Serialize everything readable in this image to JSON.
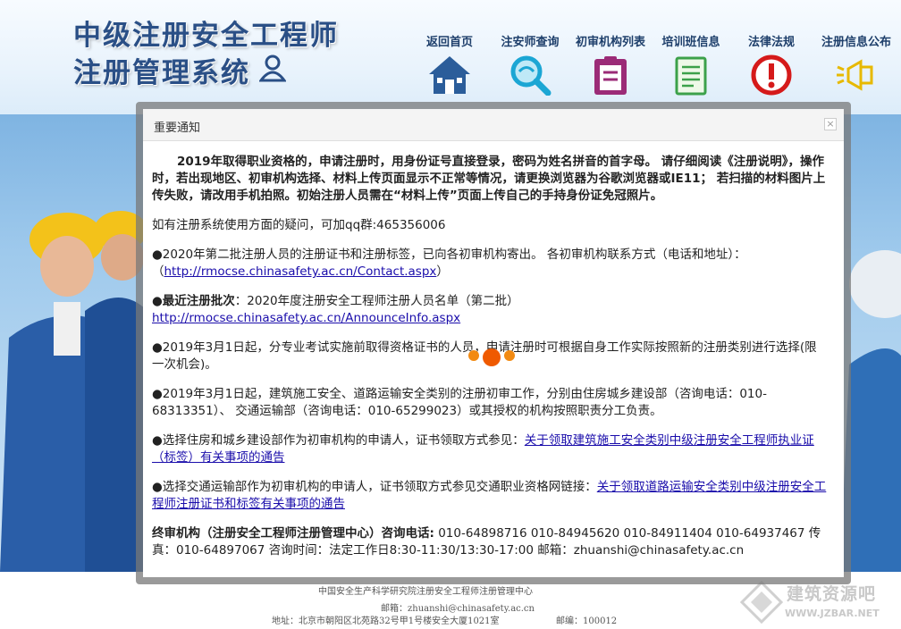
{
  "header": {
    "title_line1": "中级注册安全工程师",
    "title_line2": "注册管理系统",
    "nav": [
      {
        "label": "返回首页",
        "icon": "house-icon"
      },
      {
        "label": "注安师查询",
        "icon": "magnifier-icon"
      },
      {
        "label": "初审机构列表",
        "icon": "clipboard-icon"
      },
      {
        "label": "培训班信息",
        "icon": "document-icon"
      },
      {
        "label": "法律法规",
        "icon": "alert-icon"
      },
      {
        "label": "注册信息公布",
        "icon": "megaphone-icon"
      }
    ]
  },
  "modal": {
    "title": "重要通知",
    "close": "×",
    "intro": "2019年取得职业资格的，申请注册时，用身份证号直接登录，密码为姓名拼音的首字母。 请仔细阅读《注册说明》，操作时，若出现地区、初审机构选择、材料上传页面显示不正常等情况，请更换浏览器为谷歌浏览器或IE11； 若扫描的材料图片上传失败，请改用手机拍照。初始注册人员需在“材料上传”页面上传自己的手持身份证免冠照片。",
    "qq": "如有注册系统使用方面的疑问，可加qq群:465356006",
    "p1_text": "●2020年第二批注册人员的注册证书和注册标签，已向各初审机构寄出。 各初审机构联系方式（电话和地址）：（",
    "p1_link": "http://rmocse.chinasafety.ac.cn/Contact.aspx",
    "p1_end": "）",
    "p2_bold": "●最近注册批次",
    "p2_text": "：2020年度注册安全工程师注册人员名单（第二批）",
    "p2_link": "http://rmocse.chinasafety.ac.cn/AnnounceInfo.aspx",
    "p3": "●2019年3月1日起，分专业考试实施前取得资格证书的人员，申请注册时可根据自身工作实际按照新的注册类别进行选择(限一次机会)。",
    "p4": "●2019年3月1日起，建筑施工安全、道路运输安全类别的注册初审工作，分别由住房城乡建设部（咨询电话：010-68313351）、 交通运输部（咨询电话：010-65299023）或其授权的机构按照职责分工负责。",
    "p5_text": "●选择住房和城乡建设部作为初审机构的申请人，证书领取方式参见：",
    "p5_link": "关于领取建筑施工安全类别中级注册安全工程师执业证（标签）有关事项的通告",
    "p6_text": "●选择交通运输部作为初审机构的申请人，证书领取方式参见交通职业资格网链接：",
    "p6_link": "关于领取道路运输安全类别中级注册安全工程师注册证书和标签有关事项的通告",
    "p7_bold": "终审机构（注册安全工程师注册管理中心）咨询电话:",
    "p7_text": " 010-64898716 010-84945620 010-84911404 010-64937467 传真：010-64897067 咨询时间：法定工作日8:30-11:30/13:30-17:00 邮箱：zhuanshi@chinasafety.ac.cn"
  },
  "footer": {
    "line1": "中国安全生产科学研究院注册安全工程师注册管理中心",
    "line2": "邮箱：zhuanshi@chinasafety.ac.cn",
    "line3_addr": "地址：北京市朝阳区北苑路32号甲1号楼安全大厦1021室",
    "line3_zip": "邮编：100012"
  },
  "watermark": {
    "text": "建筑资源吧",
    "url": "WWW.JZBAR.NET"
  },
  "colors": {
    "title": "#2a4f86",
    "nav_text": "#1e3f6b",
    "link": "#1a0dab",
    "loading_dot": "#f26a00"
  }
}
